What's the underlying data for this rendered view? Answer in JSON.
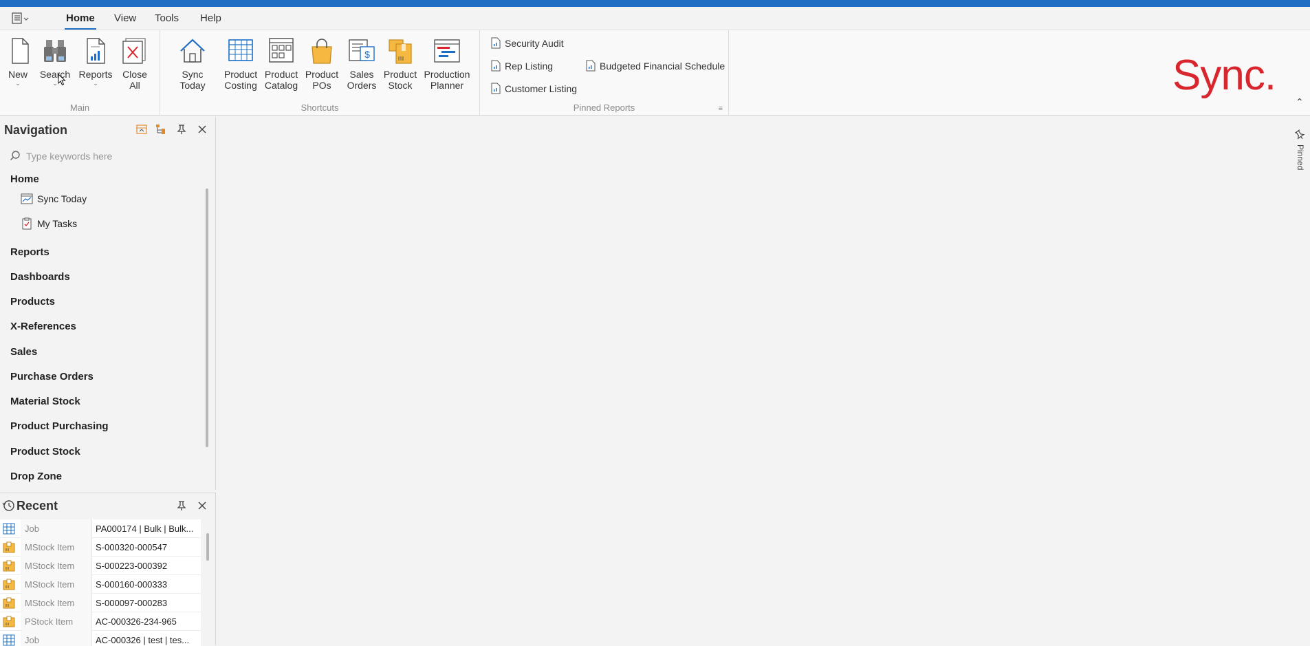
{
  "menubar": {
    "tabs": [
      {
        "label": "Home",
        "active": true
      },
      {
        "label": "View",
        "active": false
      },
      {
        "label": "Tools",
        "active": false
      },
      {
        "label": "Help",
        "active": false
      }
    ]
  },
  "ribbon": {
    "main": {
      "label": "Main",
      "buttons": [
        {
          "label": "New",
          "icon": "new-document-icon"
        },
        {
          "label": "Search",
          "icon": "binoculars-icon"
        },
        {
          "label": "Reports",
          "icon": "report-chart-icon"
        },
        {
          "label": "Close\nAll",
          "icon": "close-all-icon"
        }
      ]
    },
    "shortcuts": {
      "label": "Shortcuts",
      "buttons": [
        {
          "label": "Sync Today",
          "icon": "house-icon"
        },
        {
          "label": "Product\nCosting",
          "icon": "grid-table-icon"
        },
        {
          "label": "Product\nCatalog",
          "icon": "catalog-icon"
        },
        {
          "label": "Product\nPOs",
          "icon": "shopping-bag-icon"
        },
        {
          "label": "Sales\nOrders",
          "icon": "sales-orders-icon"
        },
        {
          "label": "Product\nStock",
          "icon": "boxes-icon"
        },
        {
          "label": "Production\nPlanner",
          "icon": "gantt-icon"
        }
      ]
    },
    "pinned": {
      "label": "Pinned Reports",
      "reports": [
        "Security Audit",
        "Rep Listing",
        "Budgeted Financial Schedule",
        "Customer Listing"
      ]
    }
  },
  "brand": {
    "logo": "Sync.",
    "color": "#d8262e"
  },
  "navigation": {
    "title": "Navigation",
    "search_placeholder": "Type keywords here",
    "sections": [
      {
        "label": "Home"
      },
      {
        "label": "Reports"
      },
      {
        "label": "Dashboards"
      },
      {
        "label": "Products"
      },
      {
        "label": "X-References"
      },
      {
        "label": "Sales"
      },
      {
        "label": "Purchase Orders"
      },
      {
        "label": "Material Stock"
      },
      {
        "label": "Product Purchasing"
      },
      {
        "label": "Product Stock"
      },
      {
        "label": "Drop Zone"
      }
    ],
    "home_items": [
      {
        "label": "Sync Today",
        "icon": "chart-window-icon"
      },
      {
        "label": "My Tasks",
        "icon": "clipboard-check-icon"
      }
    ]
  },
  "recent": {
    "title": "Recent",
    "rows": [
      {
        "type": "Job",
        "value": "PA000174 | Bulk | Bulk...",
        "icon": "job-grid-icon"
      },
      {
        "type": "MStock Item",
        "value": "S-000320-000547",
        "icon": "stock-box-icon"
      },
      {
        "type": "MStock Item",
        "value": "S-000223-000392",
        "icon": "stock-box-icon"
      },
      {
        "type": "MStock Item",
        "value": "S-000160-000333",
        "icon": "stock-box-icon"
      },
      {
        "type": "MStock Item",
        "value": "S-000097-000283",
        "icon": "stock-box-icon"
      },
      {
        "type": "PStock Item",
        "value": "AC-000326-234-965",
        "icon": "stock-box-icon"
      },
      {
        "type": "Job",
        "value": "AC-000326 | test | tes...",
        "icon": "job-grid-icon"
      }
    ]
  },
  "pinned_tab": {
    "label": "Pinned"
  },
  "colors": {
    "accent": "#1e6fc4",
    "brand": "#d8262e"
  }
}
